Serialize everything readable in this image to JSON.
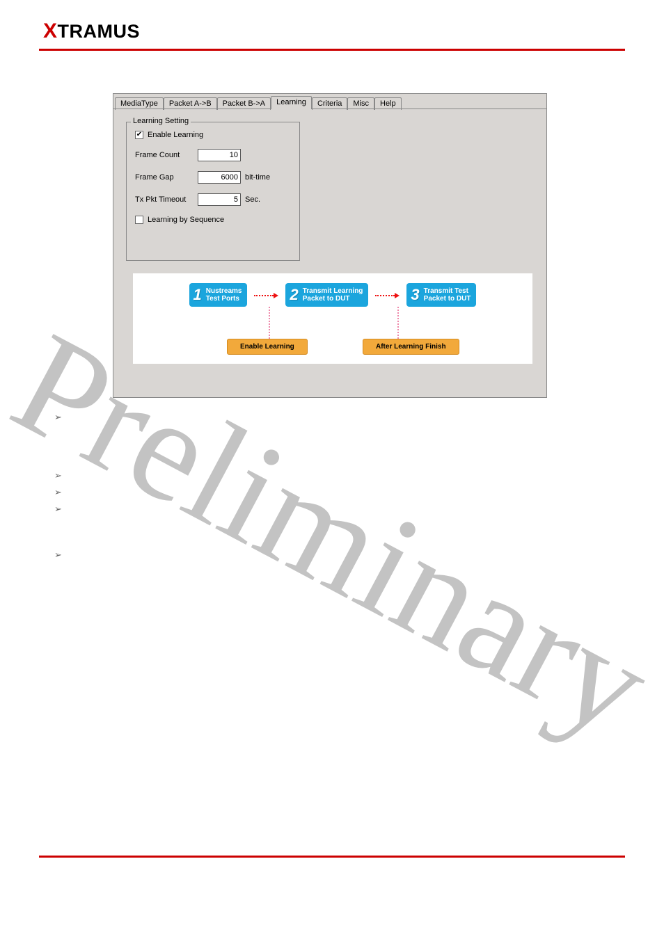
{
  "brand": {
    "x": "X",
    "rest": "TRAMUS"
  },
  "tabs": [
    "MediaType",
    "Packet A->B",
    "Packet B->A",
    "Learning",
    "Criteria",
    "Misc",
    "Help"
  ],
  "active_tab_index": 3,
  "group": {
    "legend": "Learning Setting",
    "enable_label": "Enable Learning",
    "enable_checked": true,
    "frame_count_label": "Frame Count",
    "frame_count_value": "10",
    "frame_gap_label": "Frame Gap",
    "frame_gap_value": "6000",
    "frame_gap_unit": "bit-time",
    "tx_timeout_label": "Tx Pkt Timeout",
    "tx_timeout_value": "5",
    "tx_timeout_unit": "Sec.",
    "seq_label": "Learning by Sequence",
    "seq_checked": false
  },
  "flow": {
    "step1_num": "1",
    "step1_line1": "Nustreams",
    "step1_line2": "Test Ports",
    "step2_num": "2",
    "step2_line1": "Transmit Learning",
    "step2_line2": "Packet to DUT",
    "step3_num": "3",
    "step3_line1": "Transmit Test",
    "step3_line2": "Packet to DUT",
    "label1": "Enable Learning",
    "label2": "After Learning Finish"
  },
  "bullet_glyph": "➢",
  "watermark": "Preliminary"
}
